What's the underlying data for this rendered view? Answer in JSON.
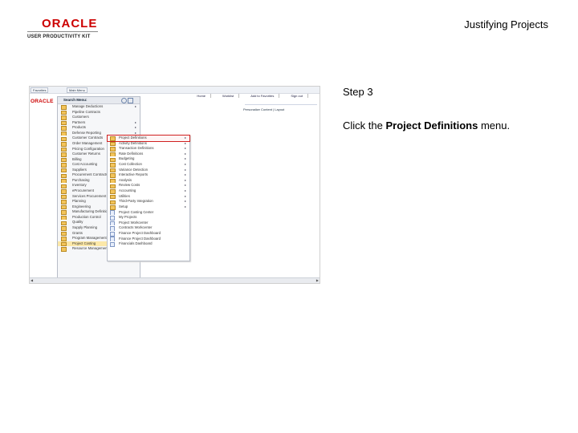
{
  "header": {
    "logo_brand": "ORACLE",
    "logo_subtitle": "USER PRODUCTIVITY KIT",
    "title": "Justifying Projects"
  },
  "step": {
    "title": "Step 3",
    "instruction_prefix": "Click the ",
    "instruction_bold": "Project Definitions",
    "instruction_suffix": " menu."
  },
  "screenshot": {
    "favorites_tab": "Favorites",
    "main_menu_tab": "Main Menu",
    "logo_mini": "ORACLE",
    "links": [
      "Home",
      "Worklist",
      "Add to Favorites",
      "Sign out"
    ],
    "personalize": "Personalize Content | Layout",
    "search_menu_label": "Search Menu:",
    "main_menu_items": [
      {
        "label": "Manage Deductions",
        "arrow": true
      },
      {
        "label": "Pipeline Contracts",
        "arrow": false
      },
      {
        "label": "Customers",
        "arrow": false
      },
      {
        "label": "Partners",
        "arrow": true
      },
      {
        "label": "Products",
        "arrow": true
      },
      {
        "label": "Defense Reporting",
        "arrow": true
      },
      {
        "label": "Customer Contracts",
        "arrow": true
      },
      {
        "label": "Order Management",
        "arrow": true
      },
      {
        "label": "Pricing Configuration",
        "arrow": true
      },
      {
        "label": "Customer Returns",
        "arrow": true
      },
      {
        "label": "Billing",
        "arrow": true
      },
      {
        "label": "Cost Accounting",
        "arrow": true
      },
      {
        "label": "Suppliers",
        "arrow": true
      },
      {
        "label": "Procurement Contracts",
        "arrow": true
      },
      {
        "label": "Purchasing",
        "arrow": true
      },
      {
        "label": "Inventory",
        "arrow": true
      },
      {
        "label": "eProcurement",
        "arrow": true
      },
      {
        "label": "Services Procurement",
        "arrow": true
      },
      {
        "label": "Planning",
        "arrow": true
      },
      {
        "label": "Engineering",
        "arrow": true
      },
      {
        "label": "Manufacturing Definitions",
        "arrow": true
      },
      {
        "label": "Production Control",
        "arrow": true
      },
      {
        "label": "Quality",
        "arrow": true
      },
      {
        "label": "Supply Planning",
        "arrow": true
      },
      {
        "label": "Grants",
        "arrow": true
      },
      {
        "label": "Program Management",
        "arrow": true
      },
      {
        "label": "Project Costing",
        "arrow": true,
        "active": true
      },
      {
        "label": "Resource Management",
        "arrow": true
      }
    ],
    "submenu_items": [
      {
        "label": "Project Definitions",
        "type": "folder",
        "highlight": true
      },
      {
        "label": "Activity Definitions",
        "type": "folder"
      },
      {
        "label": "Transaction Definitions",
        "type": "folder"
      },
      {
        "label": "Rate Definitions",
        "type": "folder"
      },
      {
        "label": "Budgeting",
        "type": "folder"
      },
      {
        "label": "Cost Collection",
        "type": "folder"
      },
      {
        "label": "Variance Detection",
        "type": "folder"
      },
      {
        "label": "Interactive Reports",
        "type": "folder"
      },
      {
        "label": "Analysis",
        "type": "folder"
      },
      {
        "label": "Review Costs",
        "type": "folder"
      },
      {
        "label": "Accounting",
        "type": "folder"
      },
      {
        "label": "Utilities",
        "type": "folder"
      },
      {
        "label": "Third-Party Integration",
        "type": "folder"
      },
      {
        "label": "Setup",
        "type": "folder"
      },
      {
        "label": "Project Costing Center",
        "type": "doc"
      },
      {
        "label": "My Projects",
        "type": "doc"
      },
      {
        "label": "Project Workcenter",
        "type": "doc"
      },
      {
        "label": "Contracts Workcenter",
        "type": "doc"
      },
      {
        "label": "Finance Project Dashboard",
        "type": "doc"
      },
      {
        "label": "Finance Project Dashboard",
        "type": "doc"
      },
      {
        "label": "Financials Dashboard",
        "type": "doc"
      }
    ]
  }
}
